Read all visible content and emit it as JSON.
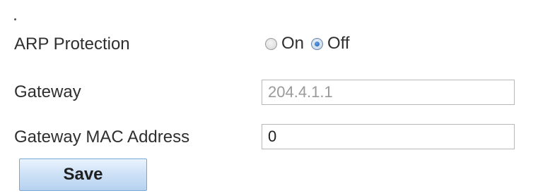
{
  "form": {
    "arp_protection": {
      "label": "ARP Protection",
      "options": [
        {
          "label": "On",
          "selected": false
        },
        {
          "label": "Off",
          "selected": true
        }
      ]
    },
    "gateway": {
      "label": "Gateway",
      "value": "204.4.1.1",
      "disabled": true
    },
    "gateway_mac": {
      "label": "Gateway MAC Address",
      "value": "0"
    },
    "save_label": "Save"
  },
  "colors": {
    "radio_selected": "#1e5fb0",
    "button_border": "#7aa6d6",
    "button_fill": "#cfe2f7",
    "disabled_text": "#9a9a9a"
  }
}
